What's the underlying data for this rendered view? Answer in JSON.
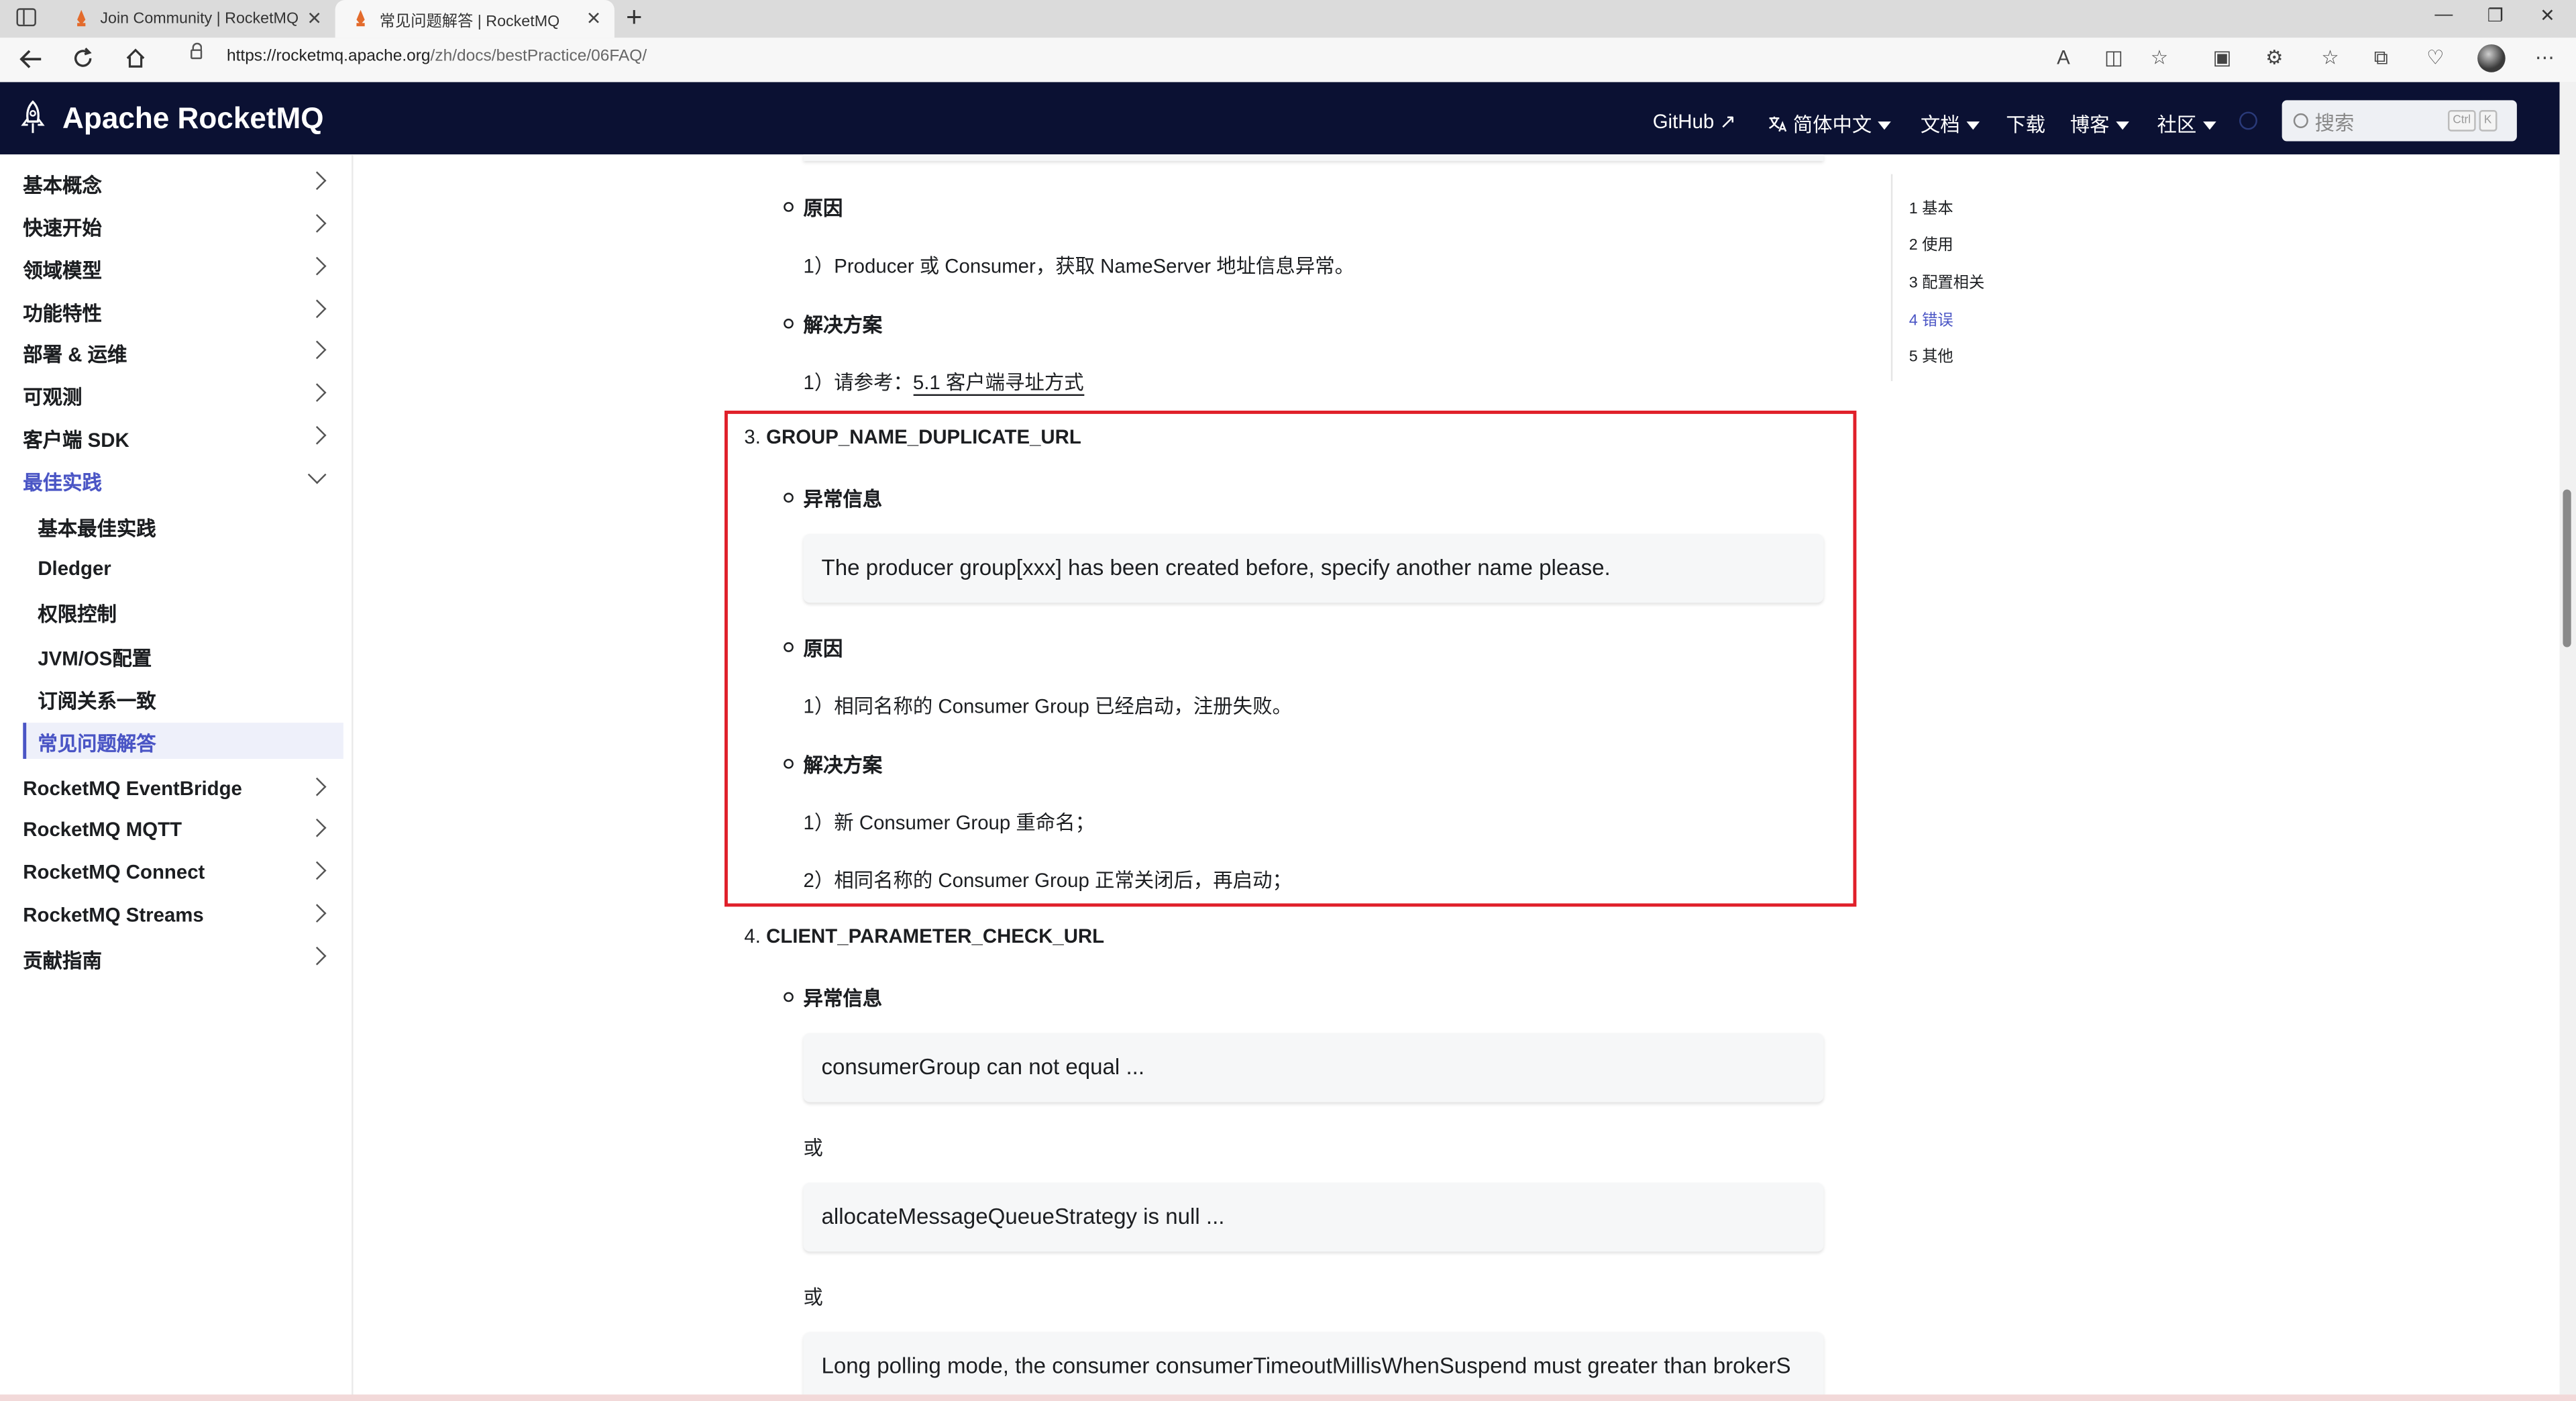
{
  "browser": {
    "tabs": [
      {
        "title": "Join Community | RocketMQ",
        "active": false
      },
      {
        "title": "常见问题解答 | RocketMQ",
        "active": true
      }
    ],
    "new_tab": "+",
    "close_glyph": "✕",
    "url_host": "https://rocketmq.apache.org",
    "url_path": "/zh/docs/bestPractice/06FAQ/",
    "window_controls": [
      "—",
      "❐",
      "✕"
    ]
  },
  "site": {
    "brand": "Apache RocketMQ",
    "nav": {
      "github": "GitHub",
      "external_glyph": "↗",
      "lang": "简体中文",
      "docs": "文档",
      "download": "下载",
      "blog": "博客",
      "community": "社区"
    },
    "search": {
      "placeholder": "搜索",
      "key1": "Ctrl",
      "key2": "K"
    }
  },
  "sidebar": {
    "items": [
      {
        "label": "基本概念"
      },
      {
        "label": "快速开始"
      },
      {
        "label": "领域模型"
      },
      {
        "label": "功能特性"
      },
      {
        "label": "部署 & 运维"
      },
      {
        "label": "可观测"
      },
      {
        "label": "客户端 SDK"
      },
      {
        "label": "最佳实践",
        "expanded": true
      }
    ],
    "sub_items": [
      {
        "label": "基本最佳实践"
      },
      {
        "label": "Dledger"
      },
      {
        "label": "权限控制"
      },
      {
        "label": "JVM/OS配置"
      },
      {
        "label": "订阅关系一致"
      },
      {
        "label": "常见问题解答",
        "active": true
      }
    ],
    "items_after": [
      {
        "label": "RocketMQ EventBridge"
      },
      {
        "label": "RocketMQ MQTT"
      },
      {
        "label": "RocketMQ Connect"
      },
      {
        "label": "RocketMQ Streams"
      },
      {
        "label": "贡献指南"
      }
    ]
  },
  "content": {
    "cause_label": "原因",
    "solution_label": "解决方案",
    "error_info_label": "异常信息",
    "or_label": "或",
    "prev": {
      "cause_text": "1）Producer 或 Consumer，获取 NameServer 地址信息异常。",
      "solution_prefix": "1）请参考：",
      "solution_link": "5.1 客户端寻址方式"
    },
    "section3": {
      "number": "3.",
      "title": "GROUP_NAME_DUPLICATE_URL",
      "error_message": "The producer group[xxx] has been created before, specify another name please.",
      "cause_text": "1）相同名称的 Consumer Group 已经启动，注册失败。",
      "solution_1": "1）新 Consumer Group 重命名；",
      "solution_2": "2）相同名称的 Consumer Group 正常关闭后，再启动；"
    },
    "section4": {
      "number": "4.",
      "title": "CLIENT_PARAMETER_CHECK_URL",
      "msg_1": "consumerGroup can not equal ...",
      "msg_2": "allocateMessageQueueStrategy is null ...",
      "msg_3": "Long polling mode, the consumer consumerTimeoutMillisWhenSuspend must greater than brokerS"
    }
  },
  "toc": [
    {
      "label": "1 基本"
    },
    {
      "label": "2 使用"
    },
    {
      "label": "3 配置相关"
    },
    {
      "label": "4 错误",
      "active": true
    },
    {
      "label": "5 其他"
    }
  ],
  "colors": {
    "nav_bg": "#0b1133",
    "accent": "#4a55c5",
    "highlight_border": "#e0202a"
  }
}
